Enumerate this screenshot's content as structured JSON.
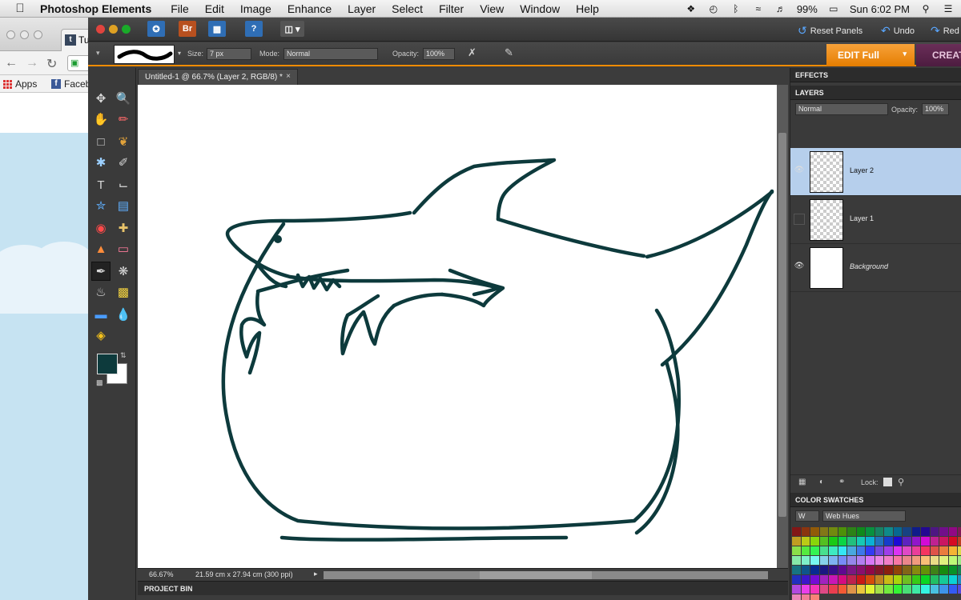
{
  "menubar": {
    "app_name": "Photoshop Elements",
    "items": [
      "File",
      "Edit",
      "Image",
      "Enhance",
      "Layer",
      "Select",
      "Filter",
      "View",
      "Window",
      "Help"
    ],
    "battery": "99%",
    "clock": "Sun 6:02 PM"
  },
  "browser": {
    "tab_title": "Tu",
    "bookmarks": {
      "apps": "Apps",
      "facebook": "Faceb"
    }
  },
  "titlebar": {
    "bridge_label": "Br",
    "help_label": "?",
    "reset_panels": "Reset Panels",
    "undo": "Undo",
    "redo": "Red"
  },
  "options": {
    "size_label": "Size:",
    "size_value": "7 px",
    "mode_label": "Mode:",
    "mode_value": "Normal",
    "opacity_label": "Opacity:",
    "opacity_value": "100%",
    "edit_full": "EDIT Full",
    "create": "CREAT"
  },
  "document": {
    "tab_title": "Untitled-1 @ 66.7% (Layer 2, RGB/8) *",
    "zoom": "66.67%",
    "dimensions": "21.59 cm x 27.94 cm (300 ppi)",
    "stroke_color": "#0d3a3c",
    "project_bin": "PROJECT BIN"
  },
  "panels": {
    "effects": "EFFECTS",
    "layers": "LAYERS",
    "blend_mode": "Normal",
    "opacity_label": "Opacity:",
    "opacity_value": "100%",
    "layer_items": [
      {
        "name": "Layer 2",
        "selected": true,
        "visible": true
      },
      {
        "name": "Layer 1",
        "selected": false,
        "visible": false
      },
      {
        "name": "Background",
        "selected": false,
        "visible": true
      }
    ],
    "lock_label": "Lock:",
    "color_swatches": "COLOR SWATCHES",
    "swatch_small_select": "W",
    "swatch_set": "Web Hues"
  },
  "colors": {
    "foreground": "#0d3a3c",
    "background": "#ffffff",
    "accent": "#f28b00"
  }
}
